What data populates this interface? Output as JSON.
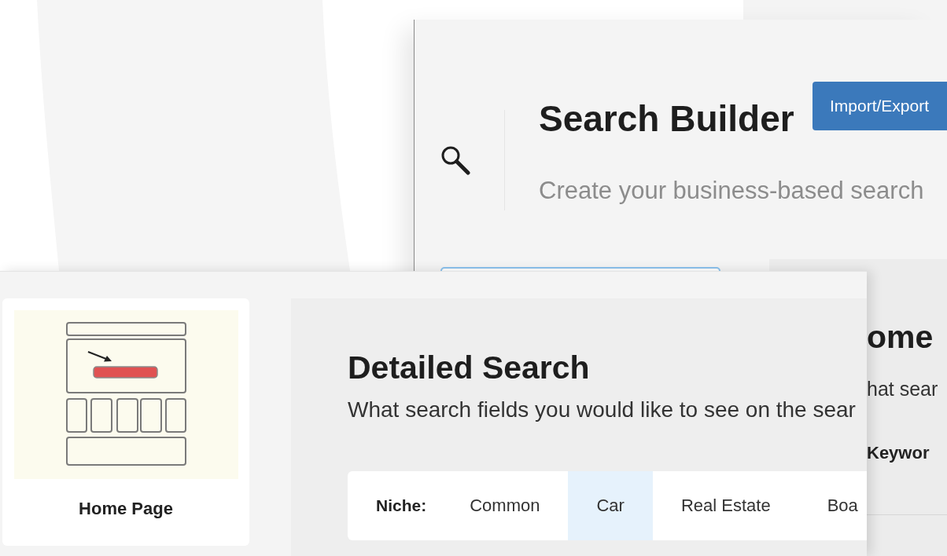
{
  "search_builder": {
    "title": "Search Builder",
    "subtitle": "Create your business-based search",
    "import_export_button": "Import/Export"
  },
  "home_page_card": {
    "label": "Home Page"
  },
  "detailed_search": {
    "title": "Detailed Search",
    "subtitle": "What search fields you would like to see on the sear",
    "niche_label": "Niche:",
    "tabs": [
      {
        "label": "Common",
        "selected": false
      },
      {
        "label": "Car",
        "selected": true
      },
      {
        "label": "Real Estate",
        "selected": false
      },
      {
        "label": "Boa",
        "selected": false
      }
    ]
  },
  "home_panel": {
    "title": "ome",
    "subtitle": "hat sear",
    "field_label": "Keywor"
  }
}
